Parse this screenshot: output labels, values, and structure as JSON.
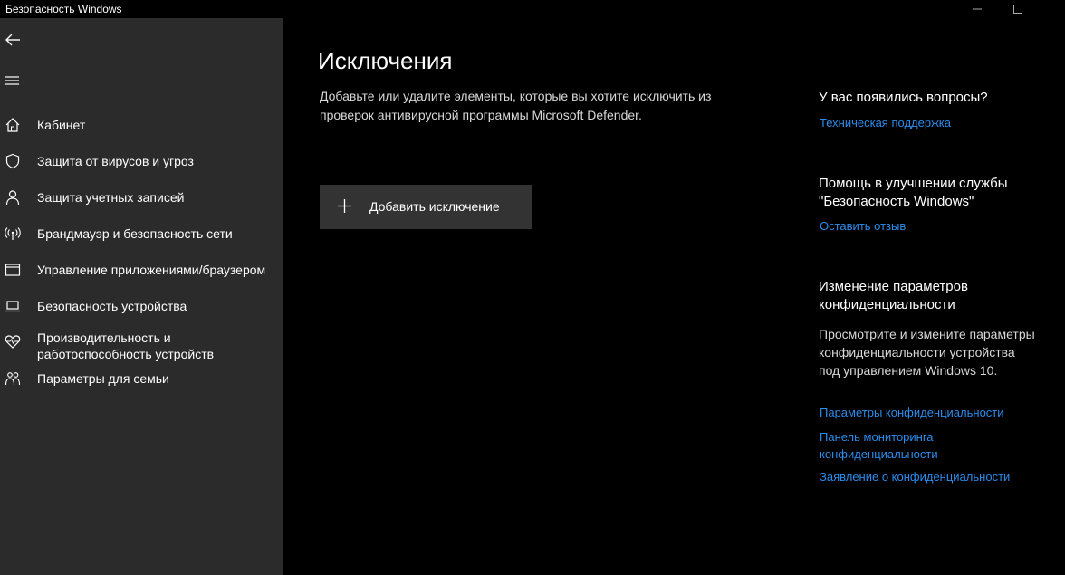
{
  "window": {
    "title": "Безопасность Windows"
  },
  "sidebar": {
    "items": [
      {
        "label": "Кабинет",
        "icon": "home-icon"
      },
      {
        "label": "Защита от вирусов и угроз",
        "icon": "shield-icon"
      },
      {
        "label": "Защита учетных записей",
        "icon": "person-icon"
      },
      {
        "label": "Брандмауэр и безопасность сети",
        "icon": "wifi-antenna-icon"
      },
      {
        "label": "Управление приложениями/браузером",
        "icon": "app-window-icon"
      },
      {
        "label": "Безопасность устройства",
        "icon": "laptop-icon"
      },
      {
        "label": "Производительность и\nработоспособность устройств",
        "icon": "heart-pulse-icon"
      },
      {
        "label": "Параметры для семьи",
        "icon": "family-icon"
      }
    ]
  },
  "main": {
    "title": "Исключения",
    "description": "Добавьте или удалите элементы, которые вы хотите исключить из проверок антивирусной программы Microsoft Defender.",
    "add_button_label": "Добавить исключение"
  },
  "side_panel": {
    "questions_heading": "У вас появились вопросы?",
    "support_link": "Техническая поддержка",
    "improve_heading": "Помощь в улучшении службы \"Безопасность Windows\"",
    "feedback_link": "Оставить отзыв",
    "privacy_heading": "Изменение параметров конфиденциальности",
    "privacy_text": "Просмотрите и измените параметры конфиденциальности устройства под управлением Windows 10.",
    "privacy_settings_link": "Параметры конфиденциальности",
    "privacy_dashboard_link": "Панель мониторинга конфиденциальности",
    "privacy_statement_link": "Заявление о конфиденциальности"
  },
  "colors": {
    "sidebar_bg": "#2b2b2b",
    "main_bg": "#000000",
    "link": "#2c8ceb",
    "button_bg": "#333333"
  }
}
